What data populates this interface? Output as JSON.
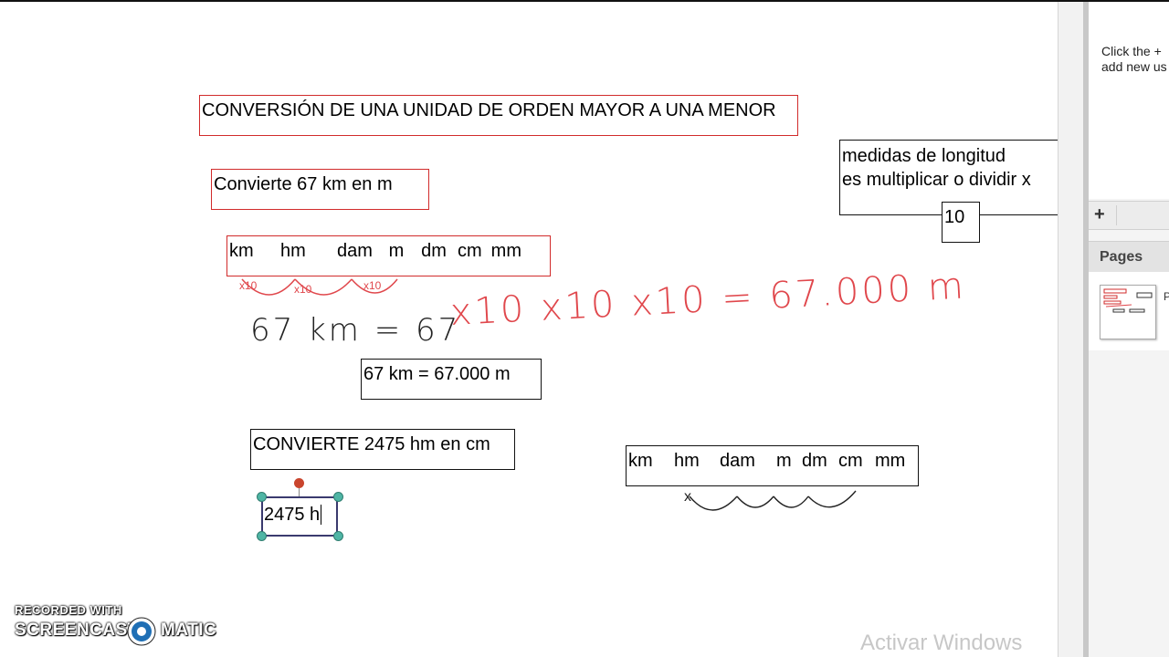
{
  "canvas": {
    "title_box": "CONVERSIÓN DE UNA UNIDAD DE ORDEN MAYOR A UNA MENOR",
    "exercise1": "Convierte 67 km en  m",
    "units_row": [
      "km",
      "hm",
      "dam",
      "m",
      "dm",
      "cm",
      "mm"
    ],
    "arc_labels": [
      "x10",
      "x10",
      "x10"
    ],
    "handwritten_black": "67 km = 67",
    "handwritten_red": "x10 x10 x10 = 67.000 m",
    "answer1": "67 km = 67.000 m",
    "exercise2": "CONVIERTE 2475 hm en cm",
    "editing_text": "2475 h",
    "units_row2": [
      "km",
      "hm",
      "dam",
      "m",
      "dm",
      "cm",
      "mm"
    ],
    "arc_label2": "x",
    "info_line1": "medidas de longitud",
    "info_line2": "es multiplicar o dividir x",
    "info_number": "10"
  },
  "side_panel": {
    "hint_line1": "Click the +",
    "hint_line2": "add new us",
    "add_button": "+",
    "pages_label": "Pages",
    "thumb_caption": "P"
  },
  "watermark": {
    "line1": "RECORDED WITH",
    "line2_left": "SCREENCAST",
    "line2_right": "MATIC"
  },
  "os_overlay": {
    "activate": "Activar Windows"
  },
  "colors": {
    "box_red": "#d12b2b",
    "ink_red": "#e0474c",
    "selection": "#4fb5a5"
  }
}
